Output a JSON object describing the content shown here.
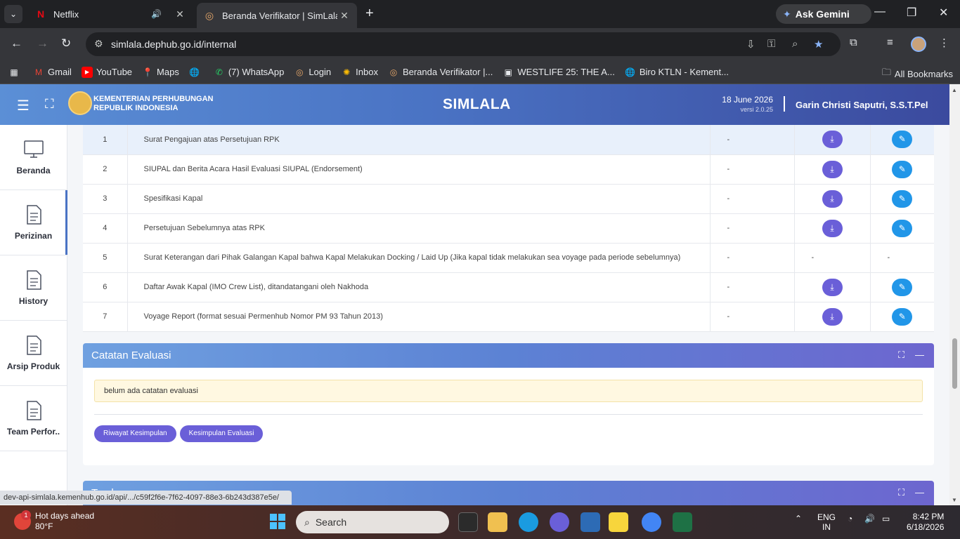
{
  "browser": {
    "tabs": [
      {
        "title": "Netflix",
        "icon": "netflix-icon"
      },
      {
        "title": "Beranda Verifikator | SimLala",
        "icon": "simlala-icon"
      }
    ],
    "gemini_label": "Ask Gemini",
    "url": "simlala.dephub.go.id/internal",
    "bookmarks": [
      "Gmail",
      "YouTube",
      "Maps",
      "(7) WhatsApp",
      "Login",
      "Inbox",
      "Beranda Verifikator |...",
      "WESTLIFE 25: THE A...",
      "Biro KTLN - Kement..."
    ],
    "all_bookmarks": "All Bookmarks",
    "status_url": "dev-api-simlala.kemenhub.go.id/api/.../c59f2f6e-7f62-4097-88e3-6b243d387e5e/"
  },
  "header": {
    "org_line1": "KEMENTERIAN PERHUBUNGAN",
    "org_line2": "REPUBLIK INDONESIA",
    "title": "SIMLALA",
    "date": "18 June 2026",
    "version": "versi 2.0.25",
    "user": "Garin Christi Saputri, S.S.T.Pel"
  },
  "sidebar": {
    "items": [
      {
        "label": "Beranda",
        "icon": "monitor-icon"
      },
      {
        "label": "Perizinan",
        "icon": "document-icon"
      },
      {
        "label": "History",
        "icon": "document-icon"
      },
      {
        "label": "Arsip Produk",
        "icon": "document-icon"
      },
      {
        "label": "Team Perfor..",
        "icon": "document-icon"
      }
    ]
  },
  "documents": {
    "rows": [
      {
        "no": "1",
        "name": "Surat Pengajuan atas Persetujuan RPK",
        "ket": "-",
        "download": true,
        "edit": true
      },
      {
        "no": "2",
        "name": "SIUPAL dan Berita Acara Hasil Evaluasi SIUPAL (Endorsement)",
        "ket": "-",
        "download": true,
        "edit": true
      },
      {
        "no": "3",
        "name": "Spesifikasi Kapal",
        "ket": "-",
        "download": true,
        "edit": true
      },
      {
        "no": "4",
        "name": "Persetujuan Sebelumnya atas RPK",
        "ket": "-",
        "download": true,
        "edit": true
      },
      {
        "no": "5",
        "name": "Surat Keterangan dari Pihak Galangan Kapal bahwa Kapal Melakukan Docking / Laid Up (Jika kapal tidak melakukan sea voyage pada periode sebelumnya)",
        "ket": "-",
        "download": false,
        "edit": false,
        "download_text": "-",
        "edit_text": "-"
      },
      {
        "no": "6",
        "name": "Daftar Awak Kapal (IMO Crew List), ditandatangani oleh Nakhoda",
        "ket": "-",
        "download": true,
        "edit": true
      },
      {
        "no": "7",
        "name": "Voyage Report (format sesuai Permenhub Nomor PM 93 Tahun 2013)",
        "ket": "-",
        "download": true,
        "edit": true
      }
    ]
  },
  "evaluasi": {
    "title": "Catatan Evaluasi",
    "note": "belum ada catatan evaluasi",
    "btn_riwayat": "Riwayat Kesimpulan",
    "btn_kesimpulan": "Kesimpulan Evaluasi"
  },
  "tembusan": {
    "title": "Tembusan"
  },
  "taskbar": {
    "weather_title": "Hot days ahead",
    "weather_temp": "80°F",
    "weather_badge": "1",
    "search": "Search",
    "lang1": "ENG",
    "lang2": "IN",
    "time": "8:42 PM",
    "date": "6/18/2026"
  },
  "colors": {
    "accent": "#4a73c4",
    "download": "#6a5fd8",
    "edit": "#2196e8",
    "note_bg": "#fff8e1"
  }
}
